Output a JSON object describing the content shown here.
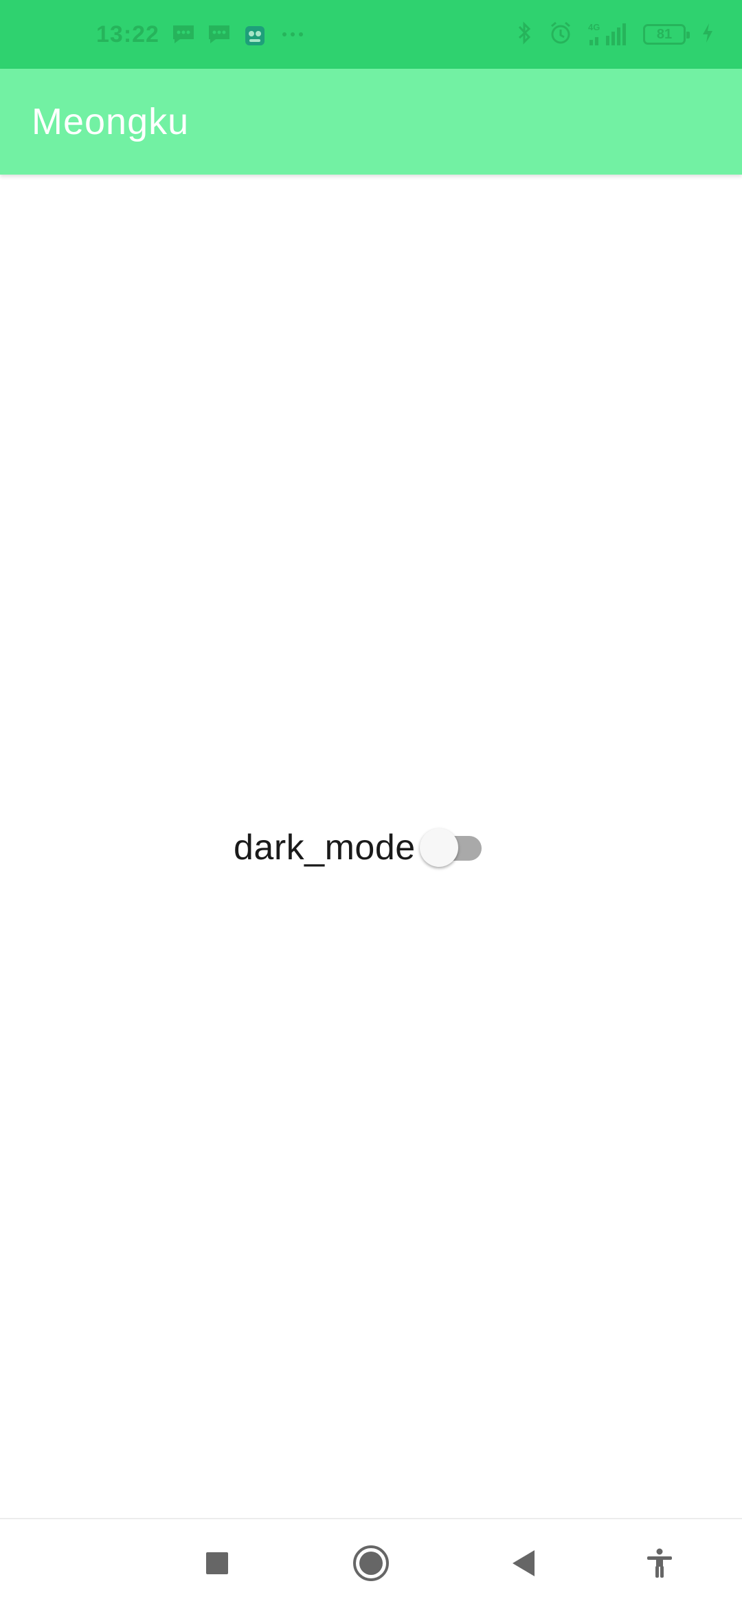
{
  "status_bar": {
    "time": "13:22",
    "battery": "81",
    "network": "4G",
    "color": "#2fd26f",
    "icons": [
      "message-icon",
      "message-icon",
      "game-app-icon",
      "more-dots-icon",
      "bluetooth-icon",
      "alarm-icon",
      "signal-icon",
      "battery-icon",
      "charging-icon"
    ]
  },
  "app_bar": {
    "title": "Meongku",
    "color": "#72f1a3"
  },
  "settings": {
    "dark_mode_label": "dark_mode",
    "dark_mode_enabled": false
  },
  "nav_bar": {
    "icons": [
      "recents-square-icon",
      "home-circle-icon",
      "back-triangle-icon",
      "accessibility-icon"
    ]
  }
}
